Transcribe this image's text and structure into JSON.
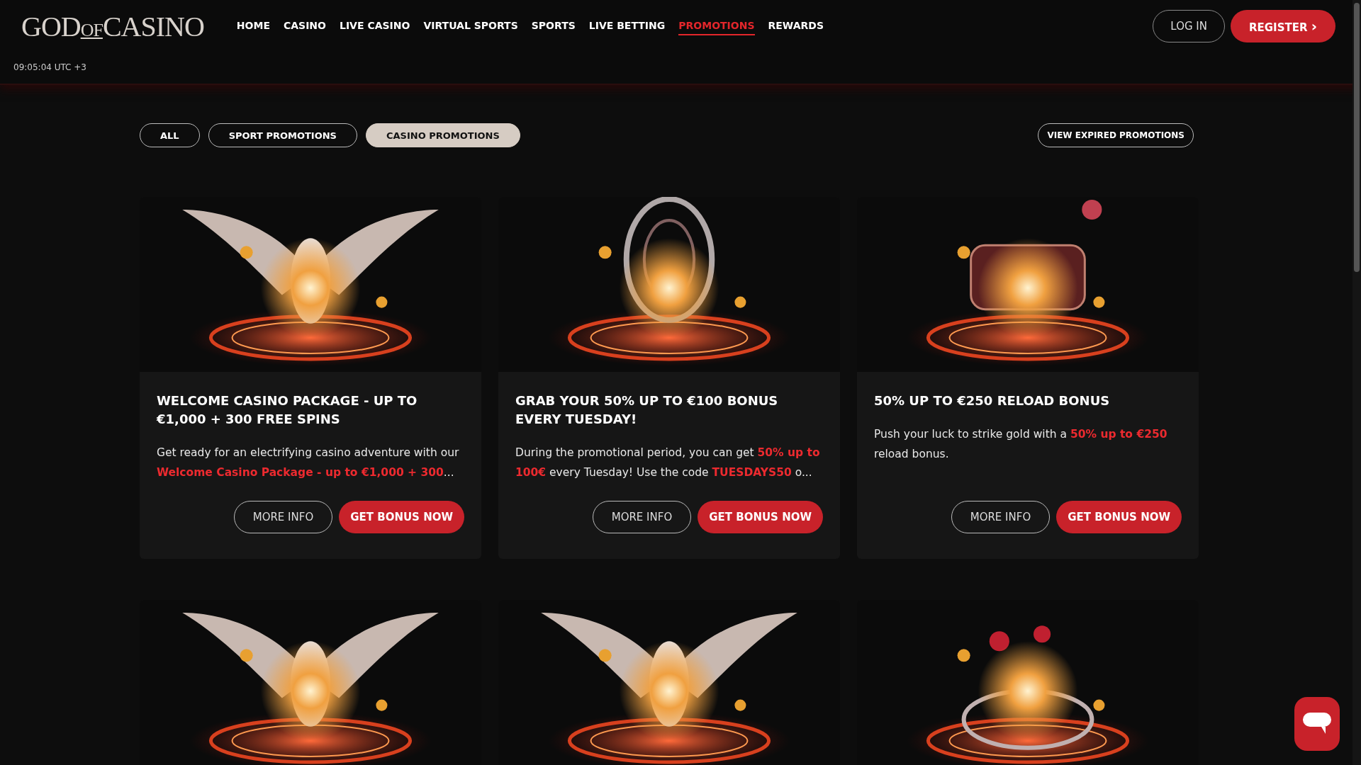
{
  "header": {
    "logo": {
      "parts": [
        "GOD",
        "OF",
        "CASINO"
      ]
    },
    "nav": [
      {
        "label": "HOME",
        "selected": false
      },
      {
        "label": "CASINO",
        "selected": false
      },
      {
        "label": "LIVE CASINO",
        "selected": false
      },
      {
        "label": "VIRTUAL SPORTS",
        "selected": false
      },
      {
        "label": "SPORTS",
        "selected": false
      },
      {
        "label": "LIVE BETTING",
        "selected": false
      },
      {
        "label": "PROMOTIONS",
        "selected": true
      },
      {
        "label": "REWARDS",
        "selected": false
      }
    ],
    "login": "LOG IN",
    "register": "REGISTER",
    "register_arrow": "›",
    "clock": "09:05:04 UTC +3"
  },
  "filters": [
    {
      "label": "ALL",
      "selected": false
    },
    {
      "label": "SPORT PROMOTIONS",
      "selected": false
    },
    {
      "label": "CASINO PROMOTIONS",
      "selected": true
    }
  ],
  "expired_button": "VIEW EXPIRED PROMOTIONS",
  "promotions": [
    {
      "kind": "promo",
      "title": "WELCOME CASINO PACKAGE - UP TO €1,000 + 300 FREE SPINS",
      "description": "Get ready for an electrifying casino adventure with our **Welcome Casino Package - up to €1,000 + 300**...",
      "buttons": [
        "MORE INFO",
        "GET BONUS NOW"
      ]
    },
    {
      "kind": "promo",
      "title": "GRAB YOUR 50% UP TO €100 BONUS EVERY TUESDAY!",
      "description": "During the promotional period, you can get **50% up to 100€** every Tuesday! Use the code **TUESDAYS50** o...",
      "buttons": [
        "MORE INFO",
        "GET BONUS NOW"
      ]
    },
    {
      "kind": "promo",
      "title": "50% UP TO €250 RELOAD BONUS",
      "description": "Push your luck to strike gold with a **50% up to €250** reload bonus.",
      "buttons": [
        "MORE INFO",
        "GET BONUS NOW"
      ]
    },
    {
      "kind": "picture"
    },
    {
      "kind": "picture"
    },
    {
      "kind": "picture"
    }
  ]
}
